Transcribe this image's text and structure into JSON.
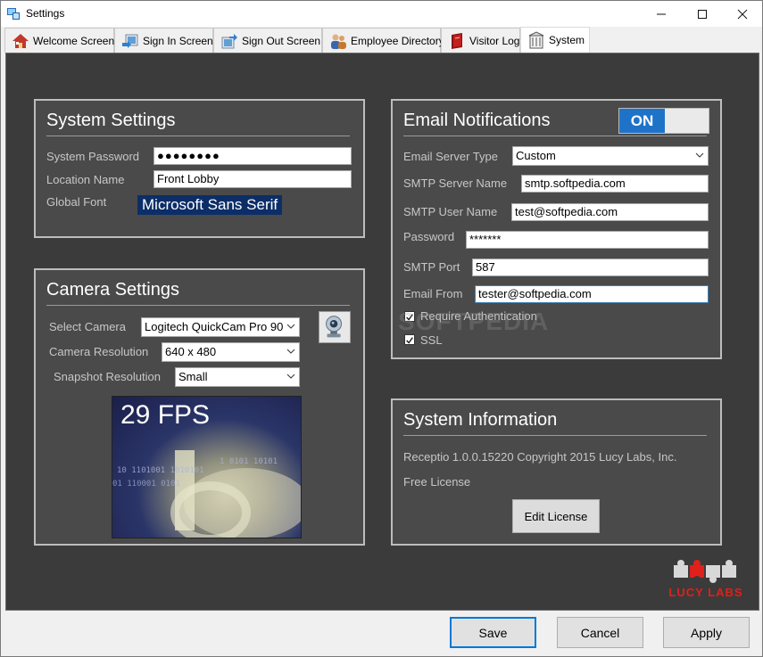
{
  "window": {
    "title": "Settings"
  },
  "tabs": [
    {
      "label": "Welcome Screen",
      "icon": "house-icon"
    },
    {
      "label": "Sign In Screen",
      "icon": "sign-in-icon"
    },
    {
      "label": "Sign Out Screen",
      "icon": "sign-out-icon"
    },
    {
      "label": "Employee Directory",
      "icon": "people-icon"
    },
    {
      "label": "Visitor Log",
      "icon": "book-icon"
    },
    {
      "label": "System",
      "icon": "building-icon",
      "active": true
    }
  ],
  "system_settings": {
    "title": "System Settings",
    "password_label": "System Password",
    "password_value": "●●●●●●●●",
    "location_label": "Location Name",
    "location_value": "Front Lobby",
    "font_label": "Global Font",
    "font_value": "Microsoft Sans Serif"
  },
  "camera_settings": {
    "title": "Camera Settings",
    "camera_label": "Select Camera",
    "camera_value": "Logitech QuickCam Pro 90",
    "resolution_label": "Camera Resolution",
    "resolution_value": "640 x 480",
    "snapshot_label": "Snapshot Resolution",
    "snapshot_value": "Small",
    "fps": "29 FPS"
  },
  "email": {
    "title": "Email Notifications",
    "toggle": "ON",
    "server_type_label": "Email Server Type",
    "server_type_value": "Custom",
    "smtp_server_label": "SMTP Server Name",
    "smtp_server_value": "smtp.softpedia.com",
    "smtp_user_label": "SMTP User Name",
    "smtp_user_value": "test@softpedia.com",
    "password_label": "Password",
    "password_value": "*******",
    "port_label": "SMTP Port",
    "port_value": "587",
    "from_label": "Email From",
    "from_value": "tester@softpedia.com",
    "require_auth_label": "Require Authentication",
    "require_auth_checked": true,
    "ssl_label": "SSL",
    "ssl_checked": true
  },
  "sysinfo": {
    "title": "System Information",
    "version": "Receptio 1.0.0.15220  Copyright 2015 Lucy Labs, Inc.",
    "license": "Free License",
    "edit_license": "Edit License"
  },
  "brand": {
    "name": "LUCY LABS",
    "color": "#e0201b"
  },
  "watermark": "SOFTPEDIA",
  "buttons": {
    "save": "Save",
    "cancel": "Cancel",
    "apply": "Apply"
  },
  "colors": {
    "accent": "#1e73c8",
    "background": "#3b3b3b",
    "panel": "#4a4a4a"
  }
}
